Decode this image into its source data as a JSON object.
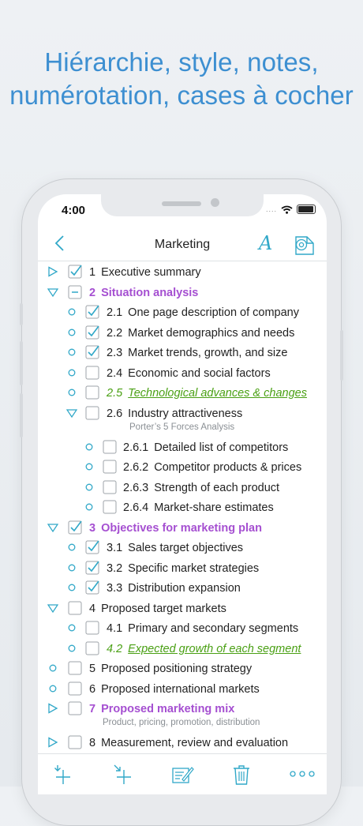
{
  "headline": {
    "line1": "Hiérarchie, style, notes,",
    "line2": "numérotation, cases à cocher"
  },
  "status": {
    "time": "4:00",
    "signal": "....",
    "icons": [
      "wifi-icon",
      "battery-icon"
    ]
  },
  "nav": {
    "title": "Marketing",
    "font_label": "A"
  },
  "colors": {
    "accent": "#31a8c8",
    "purple": "#a54fd1",
    "green": "#4aa014",
    "headline": "#3d8fd1"
  },
  "items": [
    {
      "num": "1",
      "label": "Executive summary",
      "bullet": "collapsed",
      "checked": true,
      "style": "normal",
      "level": 0
    },
    {
      "num": "2",
      "label": "Situation analysis",
      "bullet": "expanded",
      "checked": "partial",
      "style": "purple",
      "level": 0
    },
    {
      "num": "2.1",
      "label": "One page description of company",
      "bullet": "circle",
      "checked": true,
      "style": "normal",
      "level": 1
    },
    {
      "num": "2.2",
      "label": "Market demographics and needs",
      "bullet": "circle",
      "checked": true,
      "style": "normal",
      "level": 1
    },
    {
      "num": "2.3",
      "label": "Market trends, growth, and size",
      "bullet": "circle",
      "checked": true,
      "style": "normal",
      "level": 1
    },
    {
      "num": "2.4",
      "label": "Economic and social factors",
      "bullet": "circle",
      "checked": false,
      "style": "normal",
      "level": 1
    },
    {
      "num": "2.5",
      "label": "Technological advances & changes",
      "bullet": "circle",
      "checked": false,
      "style": "green",
      "level": 1
    },
    {
      "num": "2.6",
      "label": "Industry attractiveness",
      "bullet": "expanded",
      "checked": false,
      "style": "normal",
      "level": 1,
      "note": "Porter’s 5 Forces Analysis"
    },
    {
      "num": "2.6.1",
      "label": "Detailed list of competitors",
      "bullet": "circle",
      "checked": false,
      "style": "normal",
      "level": 2
    },
    {
      "num": "2.6.2",
      "label": "Competitor products & prices",
      "bullet": "circle",
      "checked": false,
      "style": "normal",
      "level": 2
    },
    {
      "num": "2.6.3",
      "label": "Strength of each product",
      "bullet": "circle",
      "checked": false,
      "style": "normal",
      "level": 2
    },
    {
      "num": "2.6.4",
      "label": "Market-share estimates",
      "bullet": "circle",
      "checked": false,
      "style": "normal",
      "level": 2
    },
    {
      "num": "3",
      "label": "Objectives for marketing plan",
      "bullet": "expanded",
      "checked": true,
      "style": "purple",
      "level": 0
    },
    {
      "num": "3.1",
      "label": "Sales target objectives",
      "bullet": "circle",
      "checked": true,
      "style": "normal",
      "level": 1
    },
    {
      "num": "3.2",
      "label": "Specific market strategies",
      "bullet": "circle",
      "checked": true,
      "style": "normal",
      "level": 1
    },
    {
      "num": "3.3",
      "label": "Distribution expansion",
      "bullet": "circle",
      "checked": true,
      "style": "normal",
      "level": 1
    },
    {
      "num": "4",
      "label": "Proposed target markets",
      "bullet": "expanded",
      "checked": false,
      "style": "normal",
      "level": 0
    },
    {
      "num": "4.1",
      "label": "Primary and secondary segments",
      "bullet": "circle",
      "checked": false,
      "style": "normal",
      "level": 1
    },
    {
      "num": "4.2",
      "label": "Expected growth of each segment",
      "bullet": "circle",
      "checked": false,
      "style": "green",
      "level": 1
    },
    {
      "num": "5",
      "label": "Proposed positioning strategy",
      "bullet": "circle",
      "checked": false,
      "style": "normal",
      "level": 0
    },
    {
      "num": "6",
      "label": "Proposed international markets",
      "bullet": "circle",
      "checked": false,
      "style": "normal",
      "level": 0
    },
    {
      "num": "7",
      "label": "Proposed marketing mix",
      "bullet": "collapsed",
      "checked": false,
      "style": "purple",
      "level": 0,
      "note": "Product, pricing, promotion, distribution"
    },
    {
      "num": "8",
      "label": "Measurement, review and evaluation",
      "bullet": "collapsed",
      "checked": false,
      "style": "normal",
      "level": 0
    }
  ],
  "toolbar": [
    "add-sibling-icon",
    "add-child-icon",
    "edit-note-icon",
    "trash-icon",
    "more-icon"
  ]
}
